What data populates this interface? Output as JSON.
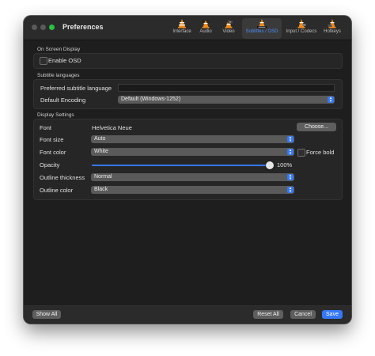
{
  "window": {
    "title": "Preferences"
  },
  "tabs": [
    {
      "label": "Interface",
      "icon": "vlc-cone-icon"
    },
    {
      "label": "Audio",
      "icon": "vlc-cone-headphones-icon"
    },
    {
      "label": "Video",
      "icon": "vlc-cone-video-icon"
    },
    {
      "label": "Subtitles / OSD",
      "icon": "vlc-cone-subtitles-icon",
      "active": true
    },
    {
      "label": "Input / Codecs",
      "icon": "vlc-cone-input-icon"
    },
    {
      "label": "Hotkeys",
      "icon": "vlc-cone-hotkeys-icon"
    }
  ],
  "osd": {
    "section_label": "On Screen Display",
    "enable_osd_label": "Enable OSD",
    "enable_osd_checked": false
  },
  "subtitle_languages": {
    "section_label": "Subtitle languages",
    "preferred_label": "Preferred subtitle language",
    "preferred_value": "",
    "encoding_label": "Default Encoding",
    "encoding_value": "Default (Windows-1252)"
  },
  "display": {
    "section_label": "Display Settings",
    "font_label": "Font",
    "font_value": "Helvetica Neue",
    "choose_label": "Choose...",
    "font_size_label": "Font size",
    "font_size_value": "Auto",
    "font_color_label": "Font color",
    "font_color_value": "White",
    "force_bold_label": "Force bold",
    "force_bold_checked": false,
    "opacity_label": "Opacity",
    "opacity_value": "100%",
    "opacity_fraction": 1.0,
    "outline_thickness_label": "Outline thickness",
    "outline_thickness_value": "Normal",
    "outline_color_label": "Outline color",
    "outline_color_value": "Black"
  },
  "footer": {
    "show_all": "Show All",
    "reset_all": "Reset All",
    "cancel": "Cancel",
    "save": "Save"
  },
  "colors": {
    "accent": "#3478f6",
    "window_bg": "#1e1e1e",
    "traffic_green": "#29c341"
  }
}
